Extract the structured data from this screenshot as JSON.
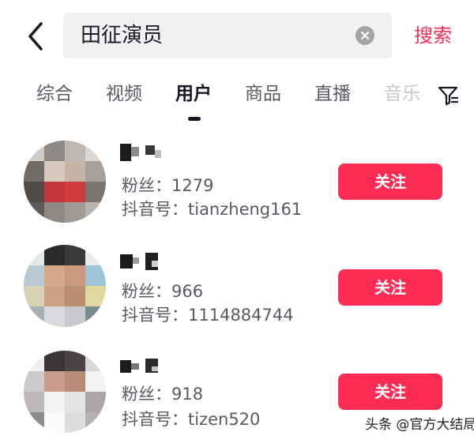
{
  "search": {
    "query": "田征演员",
    "button_label": "搜索"
  },
  "tabs": [
    {
      "label": "综合"
    },
    {
      "label": "视频"
    },
    {
      "label": "用户"
    },
    {
      "label": "商品"
    },
    {
      "label": "直播"
    },
    {
      "label": "音乐"
    }
  ],
  "active_tab": "用户",
  "users": [
    {
      "fans": "粉丝：1279",
      "douyin_id": "抖音号：tianzheng161",
      "follow_label": "关注"
    },
    {
      "fans": "粉丝：966",
      "douyin_id": "抖音号：1114884744",
      "follow_label": "关注"
    },
    {
      "fans": "粉丝：918",
      "douyin_id": "抖音号：tizen520",
      "follow_label": "关注"
    }
  ],
  "watermark": "头条 @官方大结局",
  "colors": {
    "accent": "#fe2c55",
    "text_primary": "#161823",
    "text_secondary": "#585a62",
    "search_bg": "#f1f1f2"
  },
  "icons": {
    "back": "chevron-left-icon",
    "clear": "clear-icon",
    "filter": "filter-icon"
  }
}
